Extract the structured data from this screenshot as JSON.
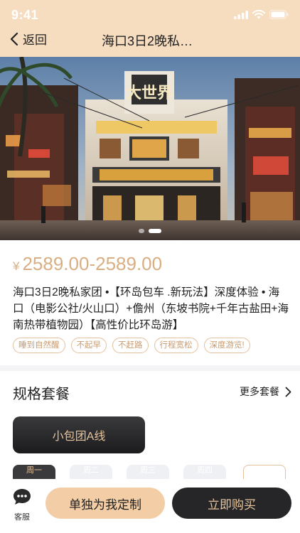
{
  "status_bar": {
    "time": "9:41"
  },
  "nav": {
    "back_label": "返回",
    "title": "海口3日2晚私…"
  },
  "hero": {
    "carousel_count": 2,
    "carousel_active": 2,
    "sign_text": "大世界"
  },
  "product": {
    "currency": "¥",
    "price_range": "2589.00-2589.00",
    "title": "海口3日2晚私家团 •【环岛包车 .新玩法】深度体验 • 海口（电影公社/火山口）+儋州（东坡书院+千年古盐田+海南热带植物园）【高性价比环岛游】",
    "tags": [
      "睡到自然醒",
      "不起早",
      "不赶路",
      "行程宽松",
      "深度游览!"
    ]
  },
  "packages": {
    "section_title": "规格套餐",
    "more_label": "更多套餐",
    "selected_label": "小包团A线",
    "date_chips": [
      "周一",
      "周二",
      "周三",
      "周四"
    ]
  },
  "bottom_bar": {
    "service_label": "客服",
    "custom_label": "单独为我定制",
    "buy_label": "立即购买"
  },
  "colors": {
    "header_bg": "#f7ddc0",
    "accent_gold": "#d9ae83",
    "button_dark": "#262628",
    "button_light": "#f2cda6"
  }
}
